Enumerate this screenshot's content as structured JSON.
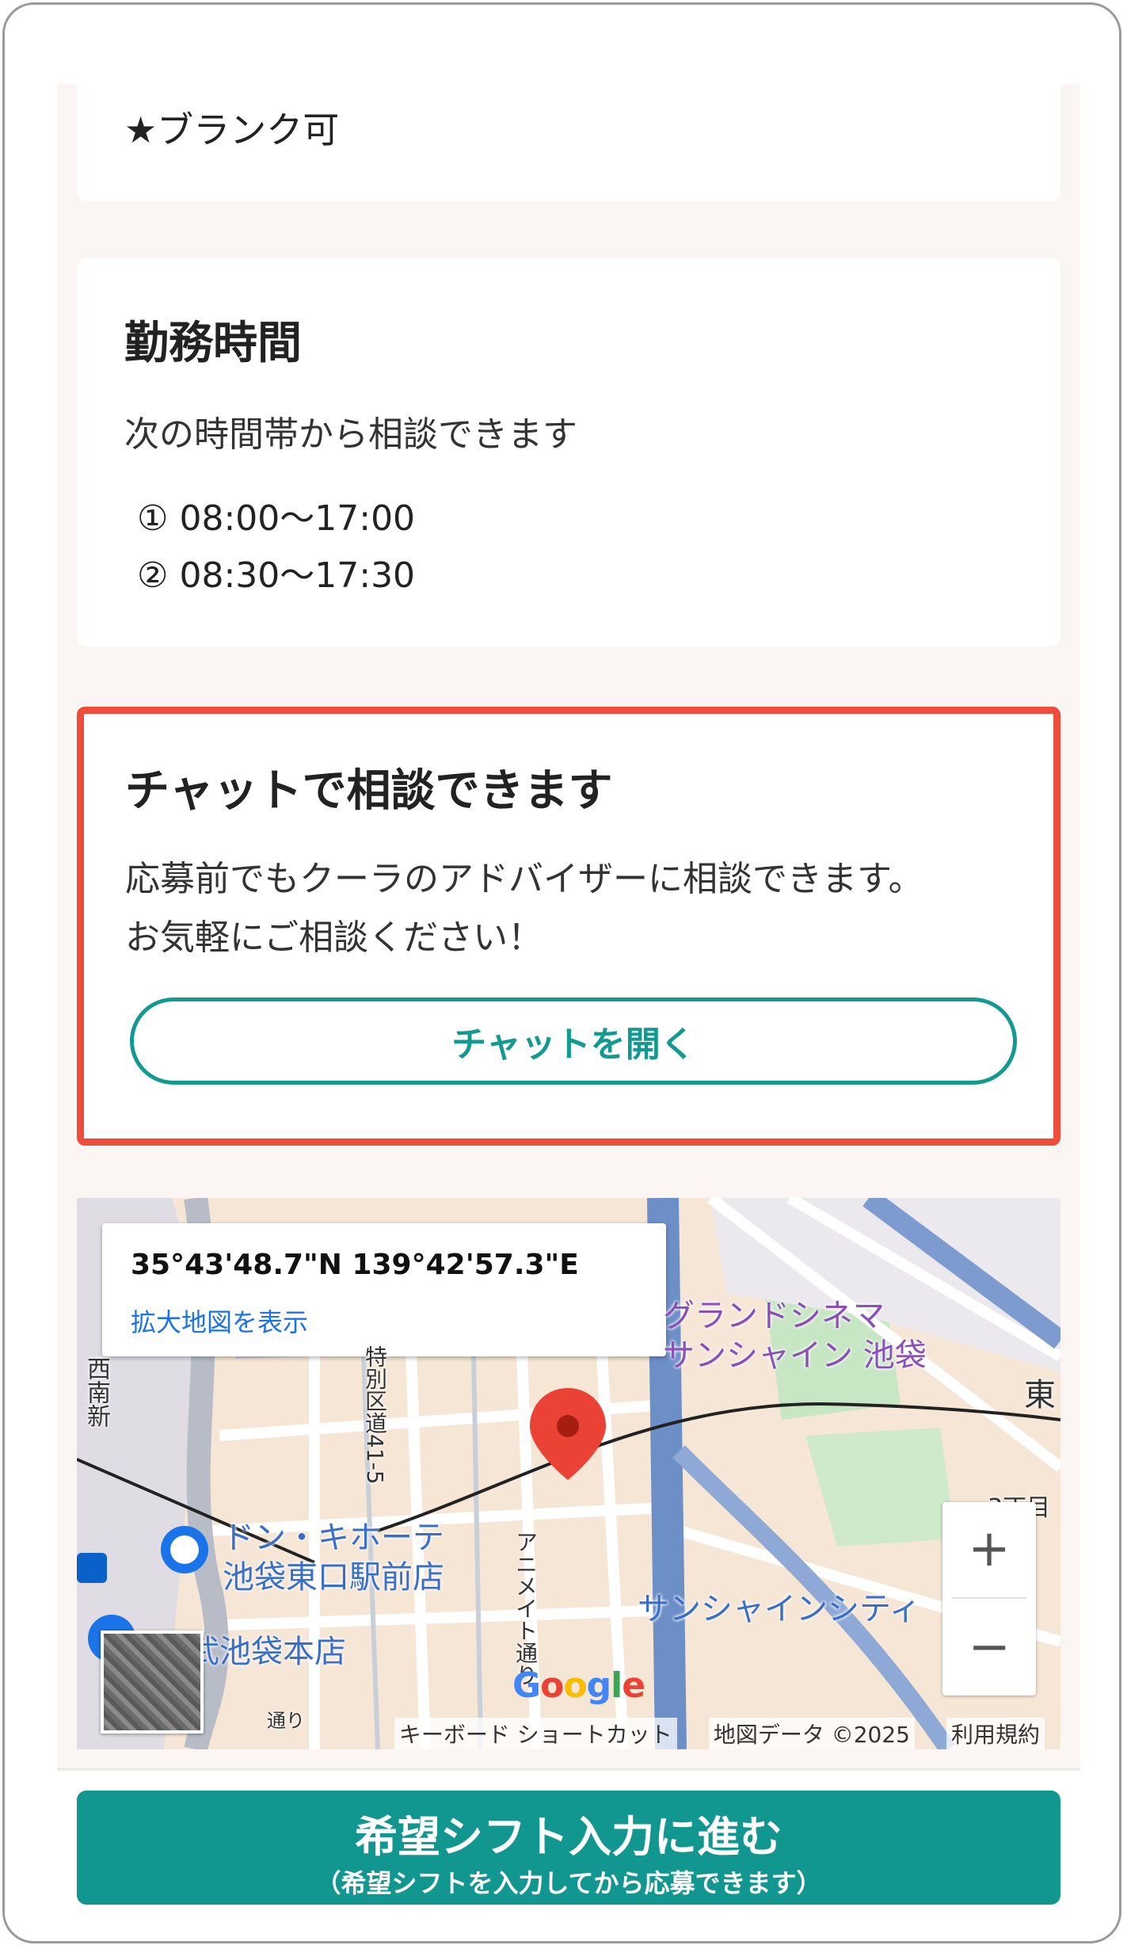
{
  "blank": {
    "text": "★ブランク可"
  },
  "hours": {
    "title": "勤務時間",
    "description": "次の時間帯から相談できます",
    "slots": [
      {
        "num": "①",
        "time": "08:00〜17:00"
      },
      {
        "num": "②",
        "time": "08:30〜17:30"
      }
    ]
  },
  "chat": {
    "title": "チャットで相談できます",
    "description_line1": "応募前でもクーラのアドバイザーに相談できます。",
    "description_line2": "お気軽にご相談ください！",
    "button_label": "チャットを開く"
  },
  "map": {
    "coords": "35°43'48.7\"N 139°42'57.3\"E",
    "link": "拡大地図を表示",
    "labels": {
      "grand_cinema_1": "グランドシネマ",
      "grand_cinema_2": "サンシャイン 池袋",
      "donki_1": "ドン・キホーテ",
      "donki_2": "池袋東口駅前店",
      "seibu": "武池袋本店",
      "sunshine_city": "サンシャインシティ",
      "east": "東",
      "tokubetsu": "特別区道41-5",
      "animate": "アニメイト通り",
      "nishi": "西南新",
      "chome": "3丁目",
      "dori": "通り"
    },
    "zoom_in": "+",
    "zoom_out": "−",
    "google": "Google",
    "attribution": {
      "shortcuts": "キーボード ショートカット",
      "data": "地図データ ©2025",
      "terms": "利用規約"
    },
    "colors": {
      "pin": "#ea4335",
      "highway": "#6d8fc7",
      "park": "#c7e6c4"
    }
  },
  "cta": {
    "main": "希望シフト入力に進む",
    "sub": "（希望シフトを入力してから応募できます）"
  },
  "colors": {
    "accent": "#119690",
    "highlight_border": "#ef4c3c"
  }
}
